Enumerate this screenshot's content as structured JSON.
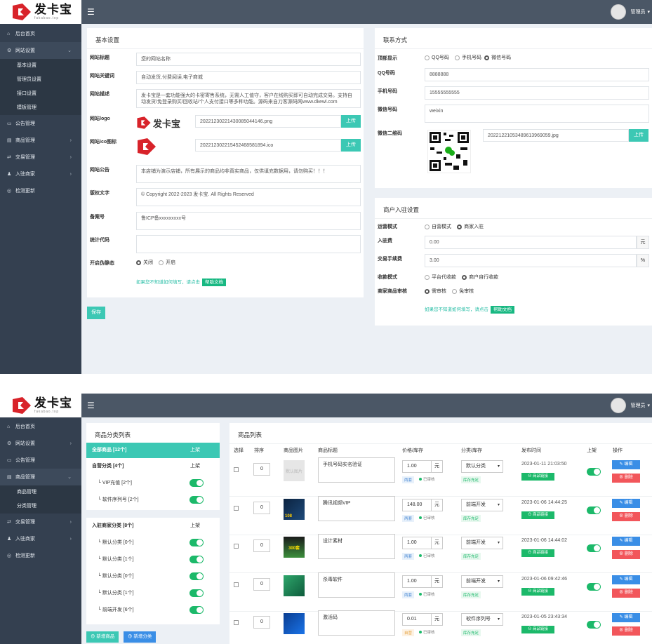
{
  "header": {
    "logo_text": "发卡宝",
    "logo_sub": "fakabao.top",
    "user": "管理员"
  },
  "s1": {
    "sidebar": [
      {
        "icon": "⌂",
        "label": "后台首页"
      },
      {
        "icon": "⚙",
        "label": "网站设置",
        "arrow": "⌄",
        "open": true
      },
      {
        "icon": "▭",
        "label": "公告管理"
      },
      {
        "icon": "▤",
        "label": "商品管理",
        "arrow": "›"
      },
      {
        "icon": "⇄",
        "label": "交易管理",
        "arrow": "›"
      },
      {
        "icon": "♟",
        "label": "入驻商家",
        "arrow": "›"
      },
      {
        "icon": "◎",
        "label": "检测更新"
      }
    ],
    "submenu": [
      "基本设置",
      "管理员设置",
      "接口设置",
      "模板管理"
    ],
    "basic": {
      "title": "基本设置",
      "fields": {
        "site_title_label": "网站标题",
        "site_title": "您的网站名称",
        "keywords_label": "网站关键词",
        "keywords": "自动发货,付费阅读,电子商城",
        "desc_label": "网站描述",
        "desc": "发卡宝是一套功能强大的卡密寄售系统，无需人工值守，客户在线购买即可自动完成交易。支持自动发货/免登录购买/回收站/个人支付接口等多种功能。源码来自刀客源码网www.dkewl.com",
        "logo_label": "网站logo",
        "logo_file": "20221230221430085044146.png",
        "ico_label": "网站ico图标",
        "ico_file": "20221230221545246858​1894.ico",
        "notice_label": "网站公告",
        "notice": "本店铺为演示店铺，所有展示的商品均非真实商品，仅供填充数据用，请勿购买！！！",
        "copyright_label": "版权文字",
        "copyright": "© Copyright 2022-2023 发卡宝. All Rights Reserved",
        "icp_label": "备案号",
        "icp": "鲁ICP备xxxxxxxxx号",
        "stat_label": "统计代码",
        "stat": "",
        "static_label": "开启伪静态",
        "static_off": "关闭",
        "static_on": "开启"
      },
      "upload": "上传",
      "help": "如果您不知道如何填写，请点击",
      "help_btn": "帮助文档",
      "save": "保存"
    },
    "contact": {
      "title": "联系方式",
      "show_label": "顶部显示",
      "opt_qq": "QQ号码",
      "opt_phone": "手机号码",
      "opt_wx": "微信号码",
      "qq_label": "QQ号码",
      "qq": "8888888",
      "phone_label": "手机号码",
      "phone": "15555555555",
      "wx_label": "微信号码",
      "wx": "weixin",
      "wxqr_label": "微信二维码",
      "wxqr_file": "20221221053489613969059.jpg",
      "upload": "上传"
    },
    "merchant": {
      "title": "商户入驻设置",
      "mode_label": "运营模式",
      "mode_self": "自营模式",
      "mode_merchant": "商家入驻",
      "fee_label": "入驻费",
      "fee": "0.00",
      "fee_unit": "元",
      "rate_label": "交易手续费",
      "rate": "3.00",
      "rate_unit": "%",
      "collect_label": "收款模式",
      "collect_a": "平台代收款",
      "collect_b": "商户自行收款",
      "audit_label": "商家商品审核",
      "audit_a": "需审核",
      "audit_b": "免审核",
      "help": "如果您不知道如何填写，请点击",
      "help_btn": "帮助文档"
    }
  },
  "s2": {
    "sidebar": [
      {
        "icon": "⌂",
        "label": "后台首页"
      },
      {
        "icon": "⚙",
        "label": "网站设置",
        "arrow": "›"
      },
      {
        "icon": "▭",
        "label": "公告管理"
      },
      {
        "icon": "▤",
        "label": "商品管理",
        "arrow": "⌄",
        "open": true
      },
      {
        "icon": "⇄",
        "label": "交易管理",
        "arrow": "›"
      },
      {
        "icon": "♟",
        "label": "入驻商家",
        "arrow": "›"
      },
      {
        "icon": "◎",
        "label": "检测更新"
      }
    ],
    "submenu": [
      "商品管理",
      "分类管理"
    ],
    "cat": {
      "title": "商品分类列表",
      "all": "全部商品 [12个]",
      "all_col": "上架",
      "self": "自营分类 [4个]",
      "self_col": "上架",
      "self_items": [
        "└ VIP充值 [2个]",
        "└ 软件序列号 [2个]"
      ],
      "merchant": "入驻商家分类 [8个]",
      "merchant_col": "上架",
      "merchant_items": [
        "└ 默认分类 [0个]",
        "└ 默认分类 [1个]",
        "└ 默认分类 [0个]",
        "└ 默认分类 [1个]",
        "└ 前端开发 [6个]"
      ],
      "add_goods": "新增商品",
      "add_cat": "新增分类"
    },
    "goods": {
      "title": "商品列表",
      "cols": [
        "选择",
        "排序",
        "商品图片",
        "商品标题",
        "价格/库存",
        "分类/库存",
        "发布时间",
        "上架",
        "操作"
      ],
      "rows": [
        {
          "sort": "0",
          "img": "默认图片",
          "title": "手机号码实名验证",
          "price": "1.00",
          "unit": "元",
          "tag": "两套",
          "status": "已审核",
          "cat": "默认分类",
          "stock": "库存充足",
          "time": "2023-01-11 21:03:50",
          "link": "商品链接",
          "edit": "编辑",
          "del": "删除"
        },
        {
          "sort": "0",
          "img": "108",
          "title": "腾讯视频VIP",
          "price": "148.00",
          "unit": "元",
          "tag": "两套",
          "status": "已审核",
          "cat": "前端开发",
          "stock": "库存充足",
          "time": "2023-01-06 14:44:25",
          "link": "商品链接",
          "edit": "编辑",
          "del": "删除"
        },
        {
          "sort": "0",
          "img": "300套",
          "title": "设计素材",
          "price": "1.00",
          "unit": "元",
          "tag": "两套",
          "status": "已审核",
          "cat": "前端开发",
          "stock": "库存充足",
          "time": "2023-01-06 14:44:02",
          "link": "商品链接",
          "edit": "编辑",
          "del": "删除"
        },
        {
          "sort": "0",
          "img": "",
          "title": "杀毒软件",
          "price": "1.00",
          "unit": "元",
          "tag": "两套",
          "status": "已审核",
          "cat": "前端开发",
          "stock": "库存充足",
          "time": "2023-01-06 09:42:46",
          "link": "商品链接",
          "edit": "编辑",
          "del": "删除"
        },
        {
          "sort": "0",
          "img": "",
          "title": "激活码",
          "price": "0.01",
          "unit": "元",
          "tag": "自营",
          "status": "已审核",
          "cat": "软件序列号",
          "stock": "库存充足",
          "time": "2023-01-05 23:43:34",
          "link": "商品链接",
          "edit": "编辑",
          "del": "删除"
        }
      ]
    }
  }
}
